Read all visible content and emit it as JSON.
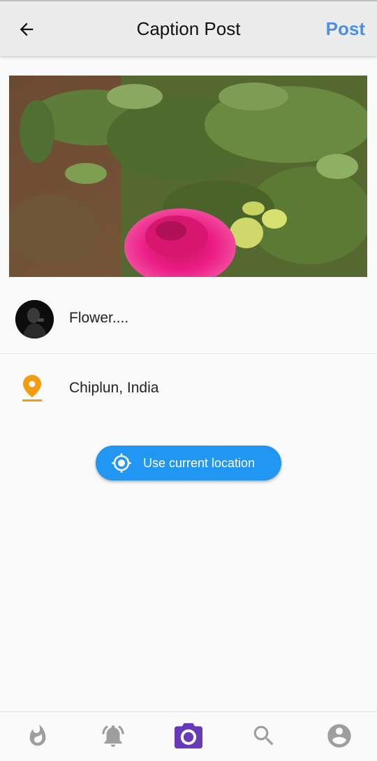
{
  "header": {
    "title": "Caption Post",
    "post_label": "Post"
  },
  "caption": {
    "text": "Flower...."
  },
  "location": {
    "text": "Chiplun, India",
    "use_current_label": "Use current location"
  },
  "colors": {
    "accent_blue": "#4a8fe8",
    "button_blue": "#2196f3",
    "pin_orange": "#f39c12",
    "nav_active": "#673ab7",
    "nav_inactive": "#9e9e9e"
  },
  "bottom_nav": [
    {
      "icon": "flame-icon",
      "active": false
    },
    {
      "icon": "bell-icon",
      "active": false
    },
    {
      "icon": "camera-icon",
      "active": true
    },
    {
      "icon": "search-icon",
      "active": false
    },
    {
      "icon": "account-icon",
      "active": false
    }
  ]
}
